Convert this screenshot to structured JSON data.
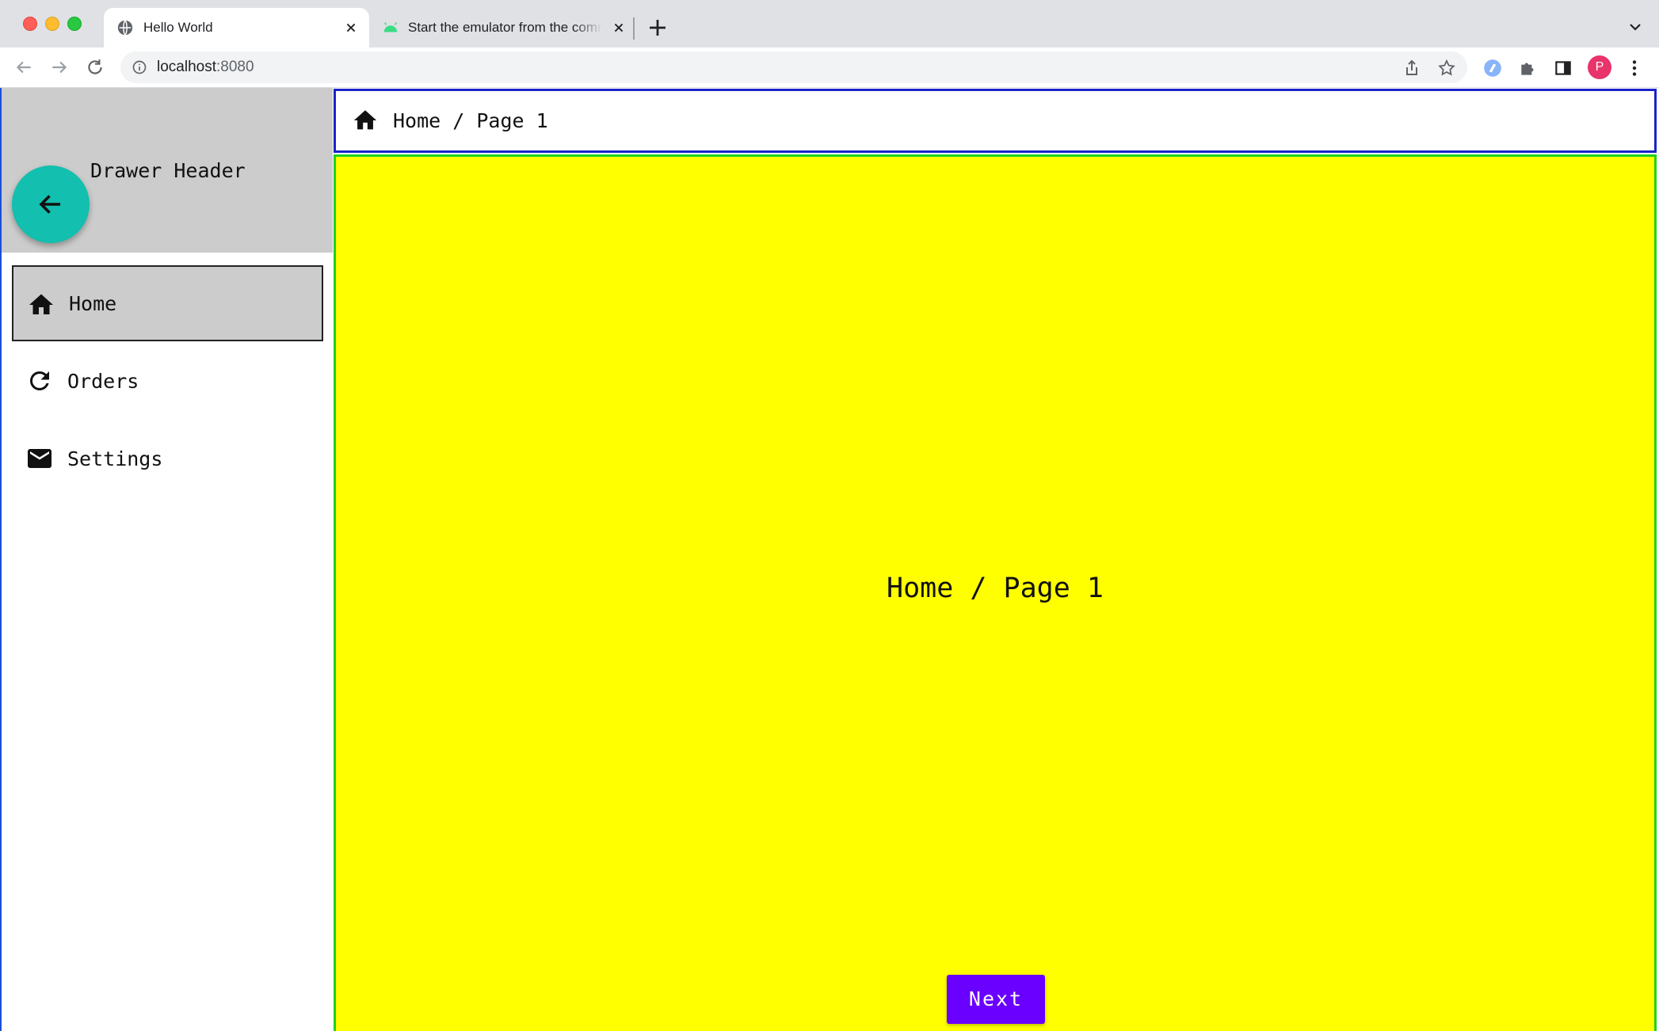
{
  "browser": {
    "tabs": [
      {
        "title": "Hello World",
        "active": true,
        "favicon": "globe-icon"
      },
      {
        "title": "Start the emulator from the command line",
        "active": false,
        "favicon": "android-icon"
      }
    ],
    "url": {
      "host": "localhost",
      "port": ":8080"
    },
    "profile_initial": "P",
    "colors": {
      "tabbar": "#dfe1e5",
      "avatar": "#e8336b"
    }
  },
  "drawer": {
    "header_title": "Drawer Header",
    "back_button_icon": "arrow-back-icon",
    "items": [
      {
        "label": "Home",
        "icon": "home-icon",
        "selected": true
      },
      {
        "label": "Orders",
        "icon": "refresh-icon",
        "selected": false
      },
      {
        "label": "Settings",
        "icon": "mail-icon",
        "selected": false
      }
    ]
  },
  "app_bar": {
    "breadcrumb": "Home / Page 1",
    "icon": "home-icon"
  },
  "content": {
    "title": "Home / Page 1",
    "next_button": "Next"
  },
  "colors": {
    "content_bg": "#ffff00",
    "content_border": "#1fd11f",
    "app_bar_border": "#1a23c9",
    "fab": "#13bfae",
    "next_button": "#6a00ff",
    "drawer_header": "#cccccc"
  }
}
